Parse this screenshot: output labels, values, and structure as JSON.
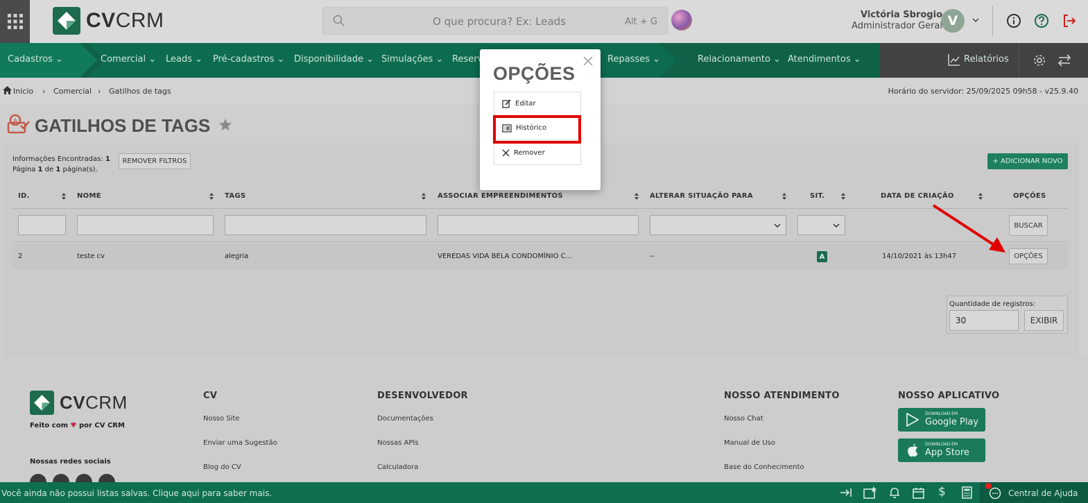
{
  "app": {
    "logo_bold": "CV",
    "logo_light": "CRM"
  },
  "search": {
    "placeholder": "O que procura? Ex: Leads",
    "shortcut": "Alt + G"
  },
  "user": {
    "name": "Victória Sbrogio",
    "role": "Administrador Geral",
    "initial": "V"
  },
  "nav": {
    "items": [
      "Cadastros",
      "Comercial",
      "Leads",
      "Pré-cadastros",
      "Disponibilidade",
      "Simulações",
      "Reserv",
      "Repasses",
      "Relacionamento",
      "Atendimentos"
    ],
    "reports": "Relatórios"
  },
  "breadcrumb": {
    "home": "Início",
    "section": "Comercial",
    "page": "Gatilhos de tags",
    "server_time": "Horário do servidor: 25/09/2025 09h58 - v25.9.40"
  },
  "page": {
    "title": "GATILHOS DE TAGS"
  },
  "info": {
    "found_label": "Informações Encontradas:",
    "found_count": "1",
    "page_word": "Página",
    "page_num": "1",
    "of_word": "de",
    "page_total": "1",
    "pages_suffix": "página(s)."
  },
  "buttons": {
    "remove_filters": "REMOVER FILTROS",
    "add_new": "+ ADICIONAR NOVO",
    "search": "BUSCAR",
    "options": "OPÇÕES",
    "show": "EXIBIR"
  },
  "table": {
    "headers": [
      "ID.",
      "NOME",
      "TAGS",
      "ASSOCIAR EMPREENDIMENTOS",
      "ALTERAR SITUAÇÃO PARA",
      "SIT.",
      "DATA DE CRIAÇÃO",
      "OPÇÕES"
    ],
    "rows": [
      {
        "id": "2",
        "name": "teste cv",
        "tags": "alegria",
        "enterprises": "VEREDAS VIDA BELA CONDOMÍNIO C...",
        "change_status": "--",
        "status": "A",
        "created": "14/10/2021 às 13h47"
      }
    ]
  },
  "pagination": {
    "label": "Quantidade de registros:",
    "value": "30"
  },
  "modal": {
    "title": "OPÇÕES",
    "options": [
      {
        "label": "Editar"
      },
      {
        "label": "Histórico"
      },
      {
        "label": "Remover"
      }
    ]
  },
  "footer": {
    "tagline_prefix": "Feito com",
    "tagline_suffix": "por CV CRM",
    "social_title": "Nossas redes sociais",
    "columns": [
      {
        "title": "CV",
        "links": [
          "Nosso Site",
          "Enviar uma Sugestão",
          "Blog do CV"
        ]
      },
      {
        "title": "DESENVOLVEDOR",
        "links": [
          "Documentações",
          "Nossas APIs",
          "Calculadora"
        ]
      },
      {
        "title": "NOSSO ATENDIMENTO",
        "links": [
          "Nosso Chat",
          "Manual de Uso",
          "Base do Conhecimento"
        ]
      },
      {
        "title": "NOSSO APLICATIVO",
        "stores": [
          {
            "small": "DOWNLOAD EM",
            "name": "Google Play"
          },
          {
            "small": "DOWNLOAD EM",
            "name": "App Store"
          }
        ]
      }
    ]
  },
  "statusbar": {
    "message": "Você ainda não possui listas salvas. Clique aqui para saber mais.",
    "help": "Central de Ajuda"
  },
  "colors": {
    "primary_green": "#0f6148",
    "accent_red": "#e00000",
    "badge_green": "#1c6b4c"
  }
}
